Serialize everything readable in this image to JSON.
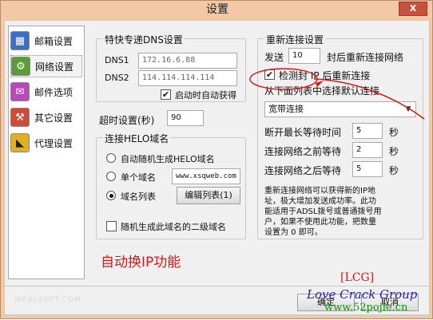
{
  "window": {
    "title": "设置",
    "close_label": "X"
  },
  "sidebar": {
    "items": [
      {
        "label": "邮箱设置",
        "icon": "mailbox-settings-icon",
        "glyph": "▦"
      },
      {
        "label": "网络设置",
        "icon": "network-settings-icon",
        "glyph": "⚙"
      },
      {
        "label": "邮件选项",
        "icon": "mail-options-icon",
        "glyph": "✉"
      },
      {
        "label": "其它设置",
        "icon": "other-settings-icon",
        "glyph": "⚒"
      },
      {
        "label": "代理设置",
        "icon": "proxy-settings-icon",
        "glyph": "◣"
      }
    ]
  },
  "dns": {
    "group_label": "特快专递DNS设置",
    "dns1_label": "DNS1",
    "dns1_value": "172.16.6.88",
    "dns2_label": "DNS2",
    "dns2_value": "114.114.114.114",
    "auto_label": "启动时自动获得",
    "auto_checked": true
  },
  "timeout": {
    "label": "超时设置(秒)",
    "value": "90"
  },
  "helo": {
    "group_label": "连接HELO域名",
    "random_label": "自动随机生成HELO域名",
    "single_label": "单个域名",
    "single_value": "www.xsqweb.com",
    "list_label": "域名列表",
    "edit_list_label": "编辑列表(1)",
    "random_secondary_label": "随机生成此域名的二级域名"
  },
  "reconnect": {
    "group_label": "重新连接设置",
    "send_label": "发送",
    "send_value": "10",
    "send_suffix": "封后重新连接网络",
    "check_label": "检测封 IP 后重新连接",
    "check_checked": true,
    "default_label": "从下面列表中选择默认连接",
    "connection_value": "宽带连接",
    "max_wait_label": "断开最长等待时间",
    "max_wait_value": "5",
    "before_wait_label": "连接网络之前等待",
    "before_wait_value": "2",
    "after_wait_label": "连接网络之后等待",
    "after_wait_value": "5",
    "seconds": "秒",
    "note_lines": [
      "重新连接网络可以获得新的IP地",
      "址，极大增加发送成功率。此功",
      "能适用于ADSL拨号或普通拨号用",
      "户，如果不使用此功能，把数量",
      "设置为 0 即可。"
    ]
  },
  "caption": "自动换IP功能",
  "footer": {
    "brand": "WEALSOFT.COM",
    "ok_label": "确定",
    "cancel_label": "取消"
  },
  "watermark": {
    "tag": "[LCG]",
    "group": "Love Crack Group",
    "url": "www.52pojie.cn"
  },
  "colors": {
    "annotation_red": "#d81818",
    "window_frame": "#f3c8a4"
  }
}
